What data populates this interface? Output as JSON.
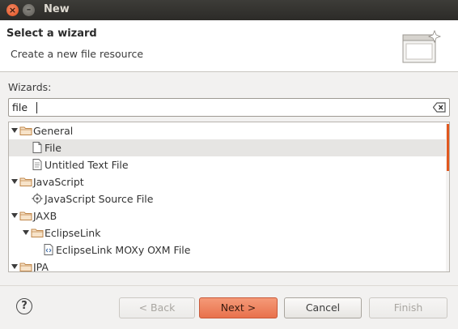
{
  "window": {
    "title": "New"
  },
  "header": {
    "title": "Select a wizard",
    "description": "Create a new file resource",
    "icon": "new-wizard-banner-icon"
  },
  "wizards": {
    "label": "Wizards:",
    "filter_value": "file",
    "tree": [
      {
        "label": "General",
        "type": "folder",
        "expanded": true,
        "level": 0
      },
      {
        "label": "File",
        "type": "file",
        "level": 1,
        "selected": true
      },
      {
        "label": "Untitled Text File",
        "type": "text-file",
        "level": 1
      },
      {
        "label": "JavaScript",
        "type": "folder",
        "expanded": true,
        "level": 0
      },
      {
        "label": "JavaScript Source File",
        "type": "js-file",
        "level": 1
      },
      {
        "label": "JAXB",
        "type": "folder",
        "expanded": true,
        "level": 0
      },
      {
        "label": "EclipseLink",
        "type": "folder",
        "expanded": true,
        "level": 1
      },
      {
        "label": "EclipseLink MOXy OXM File",
        "type": "xml-file",
        "level": 2
      },
      {
        "label": "JPA",
        "type": "folder",
        "expanded": true,
        "level": 0
      }
    ]
  },
  "buttons": {
    "help": "?",
    "back": "< Back",
    "next": "Next >",
    "cancel": "Cancel",
    "finish": "Finish"
  },
  "colors": {
    "accent": "#e8714c",
    "titlebar": "#3d3c38",
    "selection": "#e6e5e3"
  }
}
